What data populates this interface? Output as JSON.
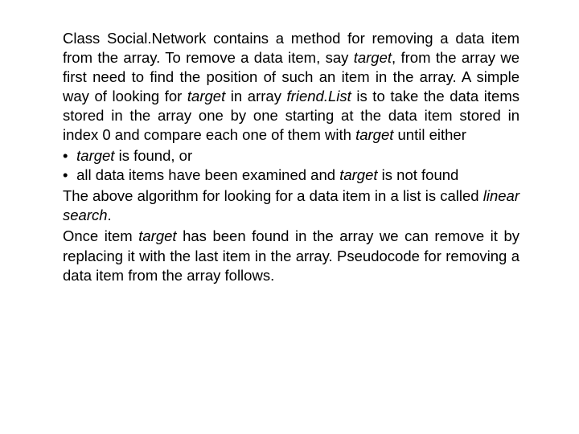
{
  "p1_a": "Class Social.Network contains a method for removing a data item from the array. To remove a data item, say ",
  "p1_b": "target",
  "p1_c": ", from the array we first need to find the position of such an item in the array. A simple way of looking for ",
  "p1_d": "target",
  "p1_e": " in array ",
  "p1_f": "friend.List",
  "p1_g": " is to take the data items stored in the array one by one starting at the data item stored in index 0 and compare each one of them with ",
  "p1_h": "target",
  "p1_i": " until either",
  "b1_a": "target",
  "b1_b": " is found, or",
  "b2_a": "all data items have been examined and ",
  "b2_b": "target",
  "b2_c": " is not found",
  "p2_a": "The above algorithm for looking for a data item in a list is called ",
  "p2_b": "linear search",
  "p2_c": ".",
  "p3_a": "Once item ",
  "p3_b": "target",
  "p3_c": " has been found in the array we can remove it by replacing it with the last item in the array. Pseudocode for removing a data item from the array follows."
}
